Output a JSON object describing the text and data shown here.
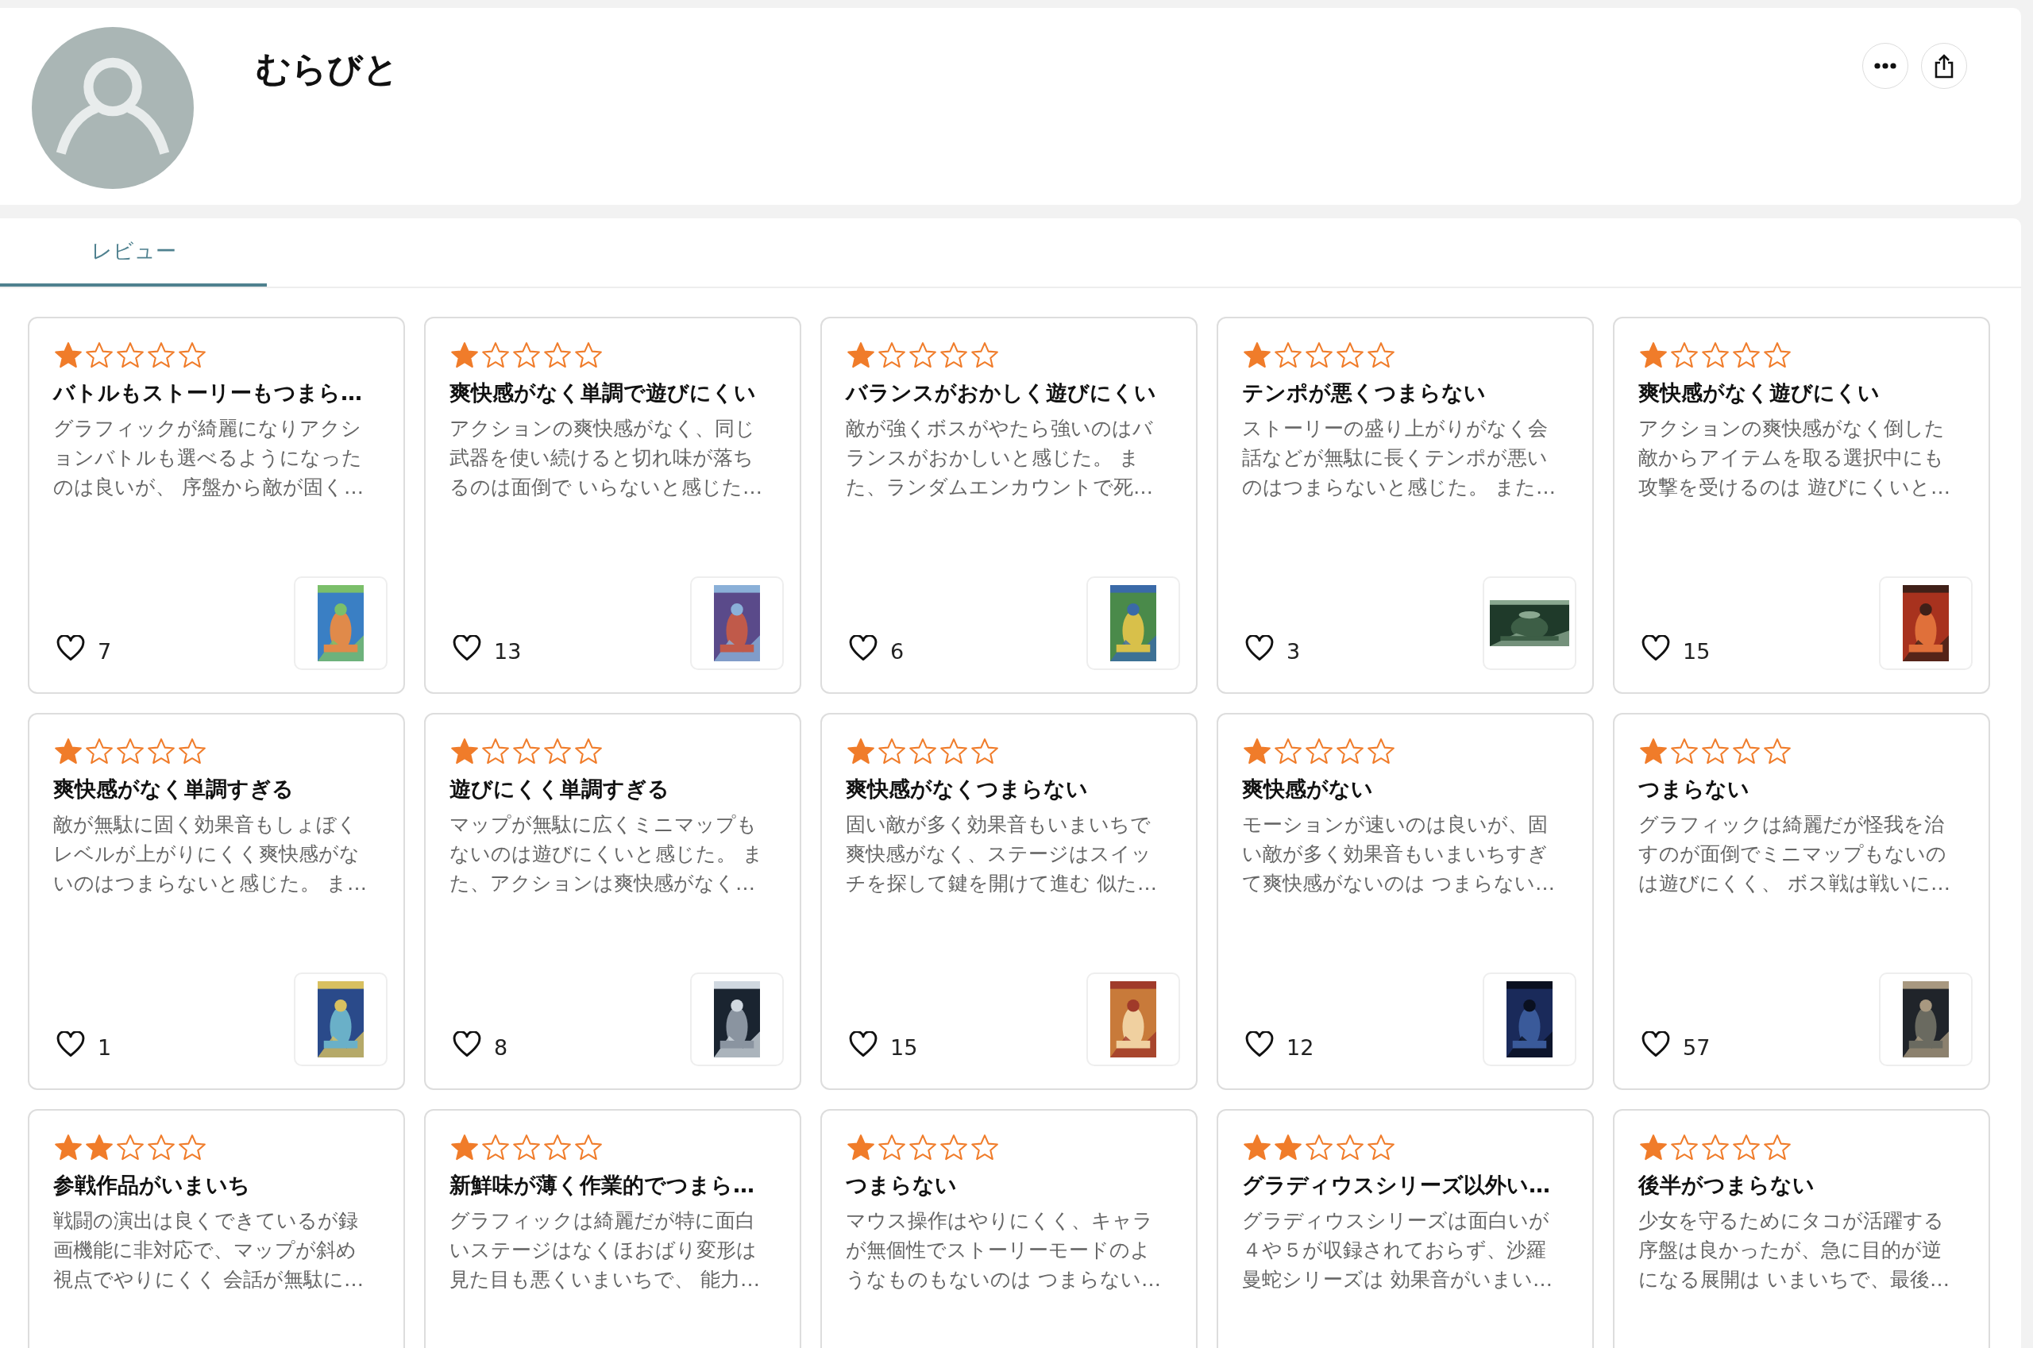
{
  "profile": {
    "name": "むらびと"
  },
  "tabs": [
    {
      "label": "レビュー",
      "selected": true
    }
  ],
  "reviews": [
    {
      "stars": 1,
      "title": "バトルもストーリーもつまら…",
      "lines": [
        "グラフィックが綺麗になりアクシ",
        "ョンバトルも選べるようになった",
        "のは良いが、 序盤から敵が固く…"
      ],
      "likes": "7"
    },
    {
      "stars": 1,
      "title": "爽快感がなく単調で遊びにくい",
      "lines": [
        "アクションの爽快感がなく、同じ",
        "武器を使い続けると切れ味が落ち",
        "るのは面倒で いらないと感じた…"
      ],
      "likes": "13"
    },
    {
      "stars": 1,
      "title": "バランスがおかしく遊びにくい",
      "lines": [
        "敵が強くボスがやたら強いのはバ",
        "ランスがおかしいと感じた。 ま",
        "た、ランダムエンカウントで死…"
      ],
      "likes": "6"
    },
    {
      "stars": 1,
      "title": "テンポが悪くつまらない",
      "lines": [
        "ストーリーの盛り上がりがなく会",
        "話などが無駄に長くテンポが悪い",
        "のはつまらないと感じた。 また…"
      ],
      "likes": "3"
    },
    {
      "stars": 1,
      "title": "爽快感がなく遊びにくい",
      "lines": [
        "アクションの爽快感がなく倒した",
        "敵からアイテムを取る選択中にも",
        "攻撃を受けるのは 遊びにくいと…"
      ],
      "likes": "15"
    },
    {
      "stars": 1,
      "title": "爽快感がなく単調すぎる",
      "lines": [
        "敵が無駄に固く効果音もしょぼく",
        "レベルが上がりにくく爽快感がな",
        "いのはつまらないと感じた。 ま…"
      ],
      "likes": "1"
    },
    {
      "stars": 1,
      "title": "遊びにくく単調すぎる",
      "lines": [
        "マップが無駄に広くミニマップも",
        "ないのは遊びにくいと感じた。 ま",
        "た、アクションは爽快感がなく…"
      ],
      "likes": "8"
    },
    {
      "stars": 1,
      "title": "爽快感がなくつまらない",
      "lines": [
        "固い敵が多く効果音もいまいちで",
        "爽快感がなく、ステージはスイッ",
        "チを探して鍵を開けて進む 似た…"
      ],
      "likes": "15"
    },
    {
      "stars": 1,
      "title": "爽快感がない",
      "lines": [
        "モーションが速いのは良いが、固",
        "い敵が多く効果音もいまいちすぎ",
        "て爽快感がないのは つまらない…"
      ],
      "likes": "12"
    },
    {
      "stars": 1,
      "title": "つまらない",
      "lines": [
        "グラフィックは綺麗だが怪我を治",
        "すのが面倒でミニマップもないの",
        "は遊びにくく、 ボス戦は戦いに…"
      ],
      "likes": "57"
    },
    {
      "stars": 2,
      "title": "参戦作品がいまいち",
      "lines": [
        "戦闘の演出は良くできているが録",
        "画機能に非対応で、マップが斜め",
        "視点でやりにくく 会話が無駄に…"
      ]
    },
    {
      "stars": 1,
      "title": "新鮮味が薄く作業的でつまら…",
      "lines": [
        "グラフィックは綺麗だが特に面白",
        "いステージはなくほおばり変形は",
        "見た目も悪くいまいちで、 能力…"
      ]
    },
    {
      "stars": 1,
      "title": "つまらない",
      "lines": [
        "マウス操作はやりにくく、キャラ",
        "が無個性でストーリーモードのよ",
        "うなものもないのは つまらない…"
      ]
    },
    {
      "stars": 2,
      "title": "グラディウスシリーズ以外い…",
      "lines": [
        "グラディウスシリーズは面白いが",
        "４や５が収録されておらず、沙羅",
        "曼蛇シリーズは 効果音がいまい…"
      ]
    },
    {
      "stars": 1,
      "title": "後半がつまらない",
      "lines": [
        "少女を守るためにタコが活躍する",
        "序盤は良かったが、急に目的が逆",
        "になる展開は いまいちで、最後…"
      ]
    }
  ]
}
